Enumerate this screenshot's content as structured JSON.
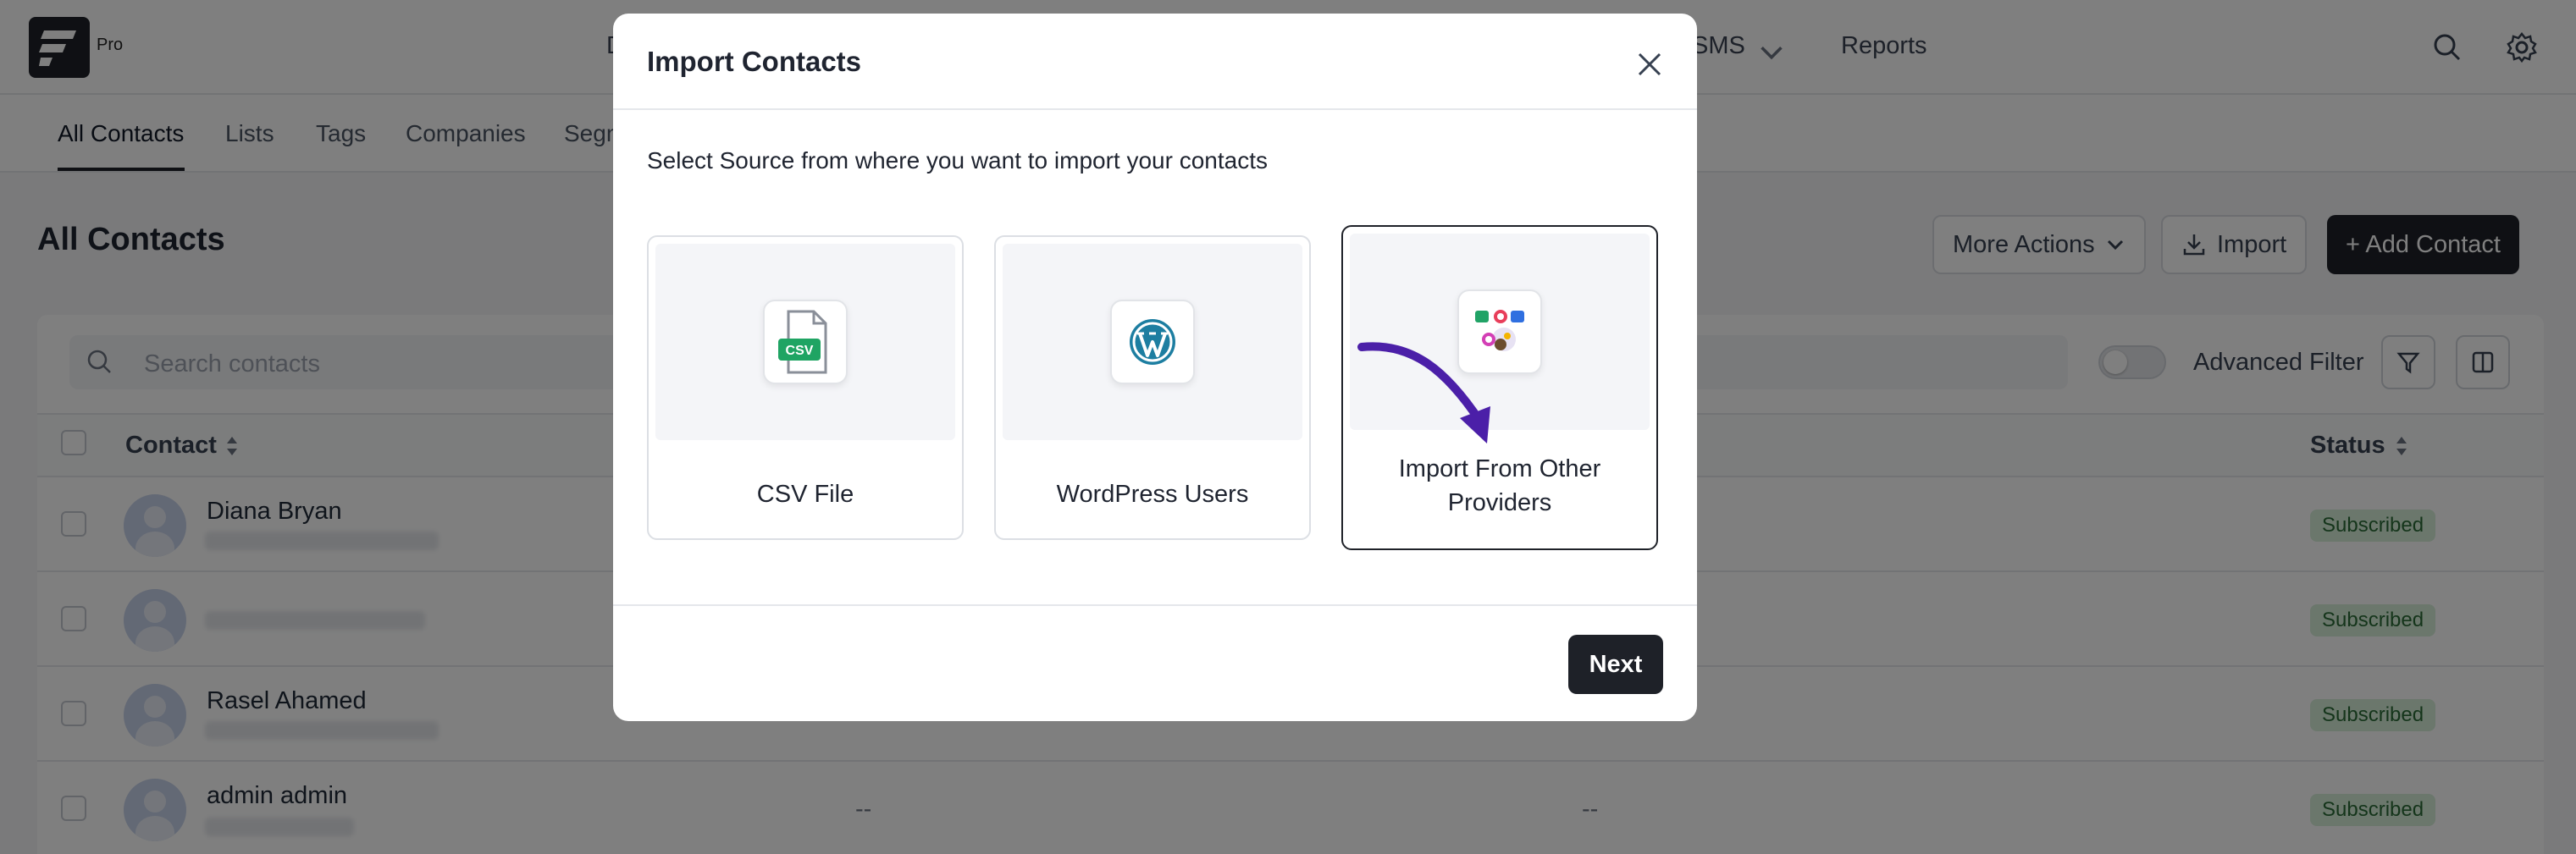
{
  "app": {
    "edition": "Pro",
    "top_nav": [
      {
        "label": "D"
      },
      {
        "label": "SMS"
      },
      {
        "label": "Reports"
      }
    ],
    "sub_nav": [
      "All Contacts",
      "Lists",
      "Tags",
      "Companies",
      "Segm"
    ],
    "page_title": "All Contacts",
    "header_buttons": {
      "more_actions": "More Actions",
      "import": "Import",
      "add_contact": "+ Add Contact"
    },
    "search_placeholder": "Search contacts",
    "advanced_filter": "Advanced Filter",
    "table": {
      "columns": {
        "contact": "Contact",
        "status": "Status"
      },
      "rows": [
        {
          "name": "Diana Bryan",
          "status": "Subscribed"
        },
        {
          "name": "",
          "status": "Subscribed"
        },
        {
          "name": "Rasel Ahamed",
          "status": "Subscribed"
        },
        {
          "name": "admin admin",
          "col2": "--",
          "col3": "--",
          "status": "Subscribed"
        }
      ]
    }
  },
  "modal": {
    "title": "Import Contacts",
    "description": "Select Source from where you want to import your contacts",
    "sources": [
      {
        "label": "CSV File",
        "icon": "csv-file-icon"
      },
      {
        "label": "WordPress Users",
        "icon": "wordpress-icon"
      },
      {
        "label": "Import From Other Providers",
        "icon": "providers-icon",
        "selected": true
      }
    ],
    "csv_badge": "CSV",
    "next_label": "Next"
  },
  "colors": {
    "primary_dark": "#1e2128",
    "badge_bg": "#d6efd9",
    "badge_text": "#2a6b37",
    "arrow": "#4b1fa8",
    "wordpress": "#1d7ea1",
    "csv_green": "#1fa463"
  }
}
